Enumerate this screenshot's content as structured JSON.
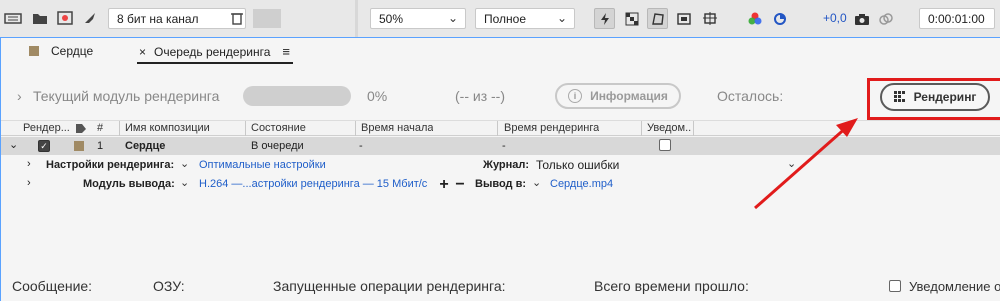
{
  "toolbar": {
    "channel_bits": "8 бит на канал",
    "zoom": "50%",
    "resolution": "Полное",
    "exposure": "+0,0",
    "timecode": "0:00:01:00"
  },
  "tabs": [
    {
      "label": "Сердце"
    },
    {
      "label": "Очередь рендеринга",
      "close": "×",
      "menu": "≡"
    }
  ],
  "status": {
    "current_module": "Текущий модуль рендеринга",
    "percent": "0%",
    "of": "(-- из --)",
    "info_button": "Информация",
    "remaining": "Осталось:",
    "render_button": "Рендеринг",
    "progress_fraction": 0
  },
  "columns": {
    "render": "Рендер...",
    "num": "#",
    "comp_name": "Имя композиции",
    "state": "Состояние",
    "start_time": "Время начала",
    "render_time": "Время рендеринга",
    "notify": "Уведом..."
  },
  "queue_item": {
    "index": "1",
    "name": "Сердце",
    "state": "В очереди",
    "start_time": "-",
    "render_time": "-",
    "checked": true
  },
  "render_settings": {
    "label": "Настройки рендеринга:",
    "value": "Оптимальные настройки",
    "log_label": "Журнал:",
    "log_value": "Только ошибки"
  },
  "output_module": {
    "label": "Модуль вывода:",
    "value": "H.264 —...астройки рендеринга — 15 Мбит/с",
    "plus": "+",
    "minus": "−",
    "output_to_label": "Вывод в:",
    "output_to_value": "Сердце.mp4"
  },
  "bottom": {
    "message": "Сообщение:",
    "ram": "ОЗУ:",
    "started": "Запущенные операции рендеринга:",
    "elapsed": "Всего времени прошло:",
    "notify": "Уведомление о з"
  },
  "colors": {
    "highlight": "#e11b1b",
    "link": "#1f5ec9",
    "panel_border": "#5aa2ff",
    "comp_swatch": "#a08a64"
  }
}
